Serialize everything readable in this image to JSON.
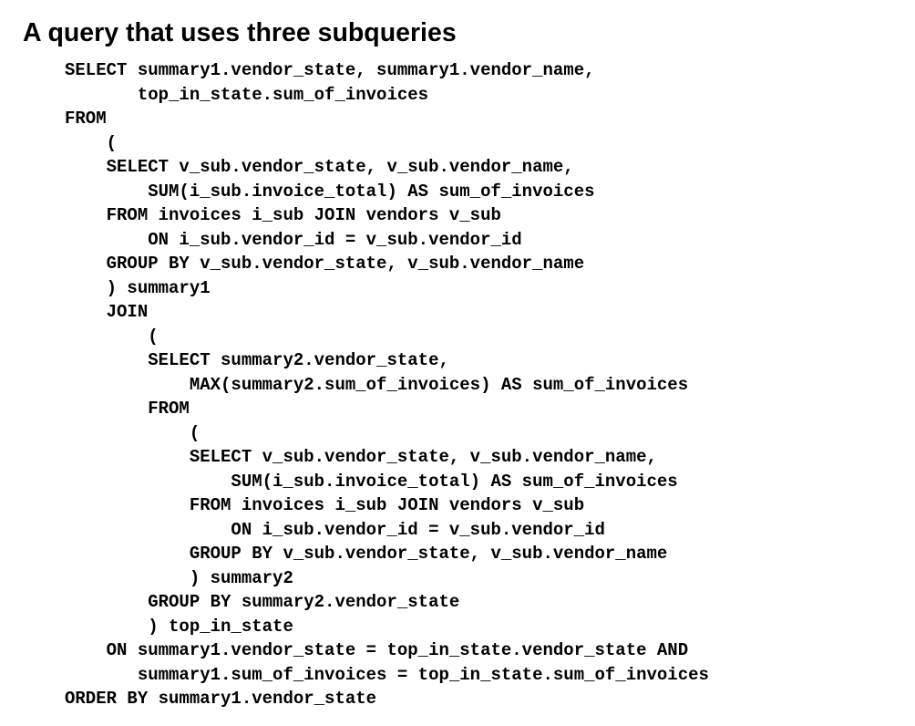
{
  "slide": {
    "title": "A query that uses three subqueries"
  },
  "code": {
    "lines": [
      "SELECT summary1.vendor_state, summary1.vendor_name,",
      "       top_in_state.sum_of_invoices",
      "FROM",
      "    (",
      "    SELECT v_sub.vendor_state, v_sub.vendor_name,",
      "        SUM(i_sub.invoice_total) AS sum_of_invoices",
      "    FROM invoices i_sub JOIN vendors v_sub",
      "        ON i_sub.vendor_id = v_sub.vendor_id",
      "    GROUP BY v_sub.vendor_state, v_sub.vendor_name",
      "    ) summary1",
      "    JOIN",
      "        (",
      "        SELECT summary2.vendor_state,",
      "            MAX(summary2.sum_of_invoices) AS sum_of_invoices",
      "        FROM",
      "            (",
      "            SELECT v_sub.vendor_state, v_sub.vendor_name,",
      "                SUM(i_sub.invoice_total) AS sum_of_invoices",
      "            FROM invoices i_sub JOIN vendors v_sub",
      "                ON i_sub.vendor_id = v_sub.vendor_id",
      "            GROUP BY v_sub.vendor_state, v_sub.vendor_name",
      "            ) summary2",
      "        GROUP BY summary2.vendor_state",
      "        ) top_in_state",
      "    ON summary1.vendor_state = top_in_state.vendor_state AND",
      "       summary1.sum_of_invoices = top_in_state.sum_of_invoices",
      "ORDER BY summary1.vendor_state"
    ]
  }
}
